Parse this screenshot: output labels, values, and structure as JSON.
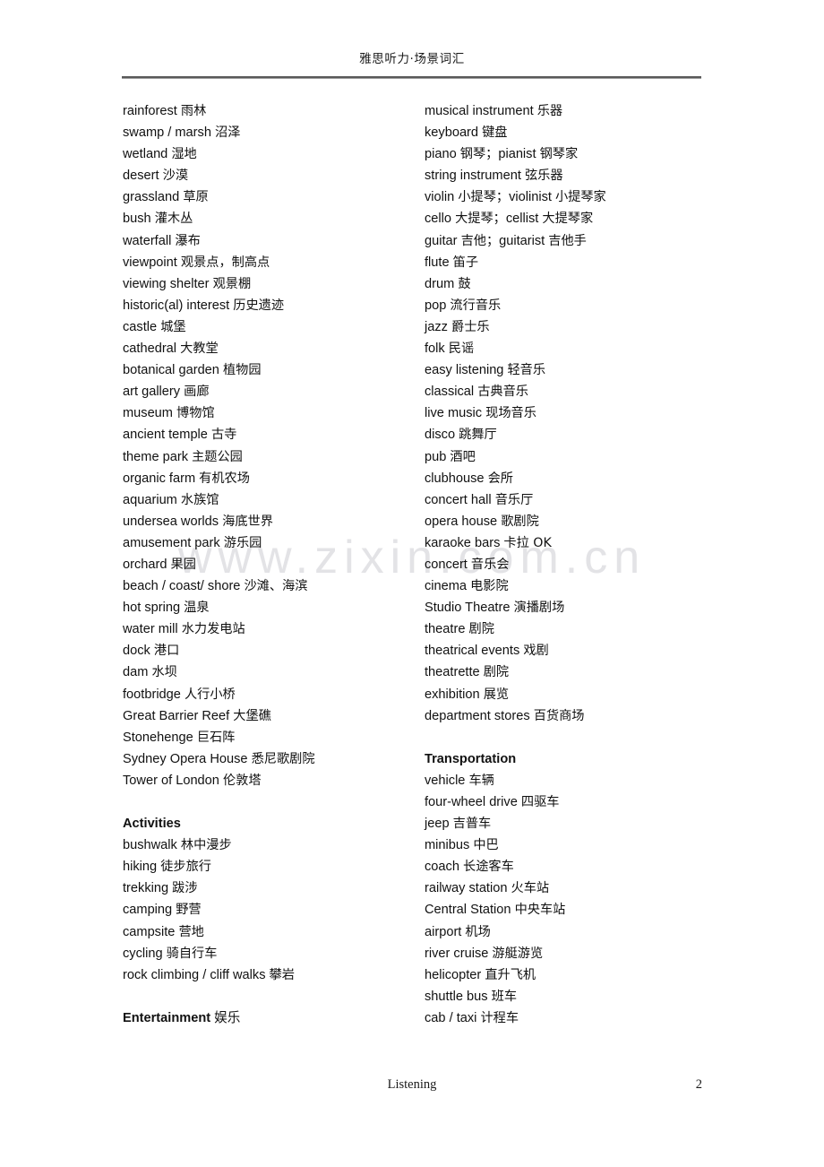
{
  "header": {
    "title": "雅思听力·场景词汇"
  },
  "watermark": {
    "text": "www.zixin.com.cn"
  },
  "footer": {
    "label": "Listening",
    "page_number": "2"
  },
  "left_column": [
    {
      "type": "entry",
      "term": "rainforest ",
      "gloss": "雨林"
    },
    {
      "type": "entry",
      "term": "swamp / marsh ",
      "gloss": " 沼泽"
    },
    {
      "type": "entry",
      "term": "wetland ",
      "gloss": "湿地"
    },
    {
      "type": "entry",
      "term": "desert ",
      "gloss": "沙漠"
    },
    {
      "type": "entry",
      "term": "grassland ",
      "gloss": "草原"
    },
    {
      "type": "entry",
      "term": "bush ",
      "gloss": "灌木丛"
    },
    {
      "type": "entry",
      "term": "waterfall ",
      "gloss": " 瀑布"
    },
    {
      "type": "entry",
      "term": "viewpoint ",
      "gloss": " 观景点，制高点"
    },
    {
      "type": "entry",
      "term": "viewing shelter ",
      "gloss": "观景棚"
    },
    {
      "type": "entry",
      "term": "historic(al) interest ",
      "gloss": "历史遗迹"
    },
    {
      "type": "entry",
      "term": "castle ",
      "gloss": "城堡"
    },
    {
      "type": "entry",
      "term": "cathedral ",
      "gloss": "大教堂"
    },
    {
      "type": "entry",
      "term": "botanical garden ",
      "gloss": "植物园"
    },
    {
      "type": "entry",
      "term": "art gallery ",
      "gloss": "画廊"
    },
    {
      "type": "entry",
      "term": "museum ",
      "gloss": "博物馆"
    },
    {
      "type": "entry",
      "term": "ancient temple ",
      "gloss": "古寺"
    },
    {
      "type": "entry",
      "term": "theme park ",
      "gloss": "主题公园"
    },
    {
      "type": "entry",
      "term": "organic farm ",
      "gloss": "有机农场"
    },
    {
      "type": "entry",
      "term": "aquarium ",
      "gloss": "水族馆"
    },
    {
      "type": "entry",
      "term": "undersea worlds ",
      "gloss": "海底世界"
    },
    {
      "type": "entry",
      "term": "amusement park ",
      "gloss": "游乐园"
    },
    {
      "type": "entry",
      "term": "orchard ",
      "gloss": "果园"
    },
    {
      "type": "entry",
      "term": "beach / coast/ shore ",
      "gloss": "沙滩、海滨"
    },
    {
      "type": "entry",
      "term": "hot spring ",
      "gloss": "温泉"
    },
    {
      "type": "entry",
      "term": "water mill ",
      "gloss": "水力发电站"
    },
    {
      "type": "entry",
      "term": "dock ",
      "gloss": "港口"
    },
    {
      "type": "entry",
      "term": "dam ",
      "gloss": "水坝"
    },
    {
      "type": "entry",
      "term": "footbridge ",
      "gloss": "人行小桥"
    },
    {
      "type": "entry",
      "term": "Great Barrier Reef ",
      "gloss": "大堡礁"
    },
    {
      "type": "entry",
      "term": "Stonehenge ",
      "gloss": "巨石阵"
    },
    {
      "type": "entry",
      "term": "Sydney Opera House ",
      "gloss": "悉尼歌剧院"
    },
    {
      "type": "entry",
      "term": "Tower of London ",
      "gloss": "伦敦塔"
    },
    {
      "type": "spacer",
      "term": "",
      "gloss": ""
    },
    {
      "type": "heading",
      "term": "Activities",
      "gloss": ""
    },
    {
      "type": "entry",
      "term": "bushwalk ",
      "gloss": "林中漫步"
    },
    {
      "type": "entry",
      "term": "hiking ",
      "gloss": "徒步旅行"
    },
    {
      "type": "entry",
      "term": "trekking ",
      "gloss": "跋涉"
    },
    {
      "type": "entry",
      "term": "camping ",
      "gloss": "野营"
    },
    {
      "type": "entry",
      "term": "campsite ",
      "gloss": "营地"
    },
    {
      "type": "entry",
      "term": "cycling ",
      "gloss": "骑自行车"
    },
    {
      "type": "entry",
      "term": "rock climbing / cliff walks ",
      "gloss": "攀岩"
    },
    {
      "type": "spacer",
      "term": "",
      "gloss": ""
    },
    {
      "type": "heading",
      "term": "Entertainment ",
      "gloss": "娱乐"
    }
  ],
  "right_column": [
    {
      "type": "entry",
      "term": "musical instrument ",
      "gloss": "乐器"
    },
    {
      "type": "entry",
      "term": "keyboard ",
      "gloss": "键盘"
    },
    {
      "type": "entry",
      "term": "piano ",
      "gloss": "钢琴；",
      "term2": "pianist ",
      "gloss2": "钢琴家"
    },
    {
      "type": "entry",
      "term": "string instrument ",
      "gloss": "弦乐器"
    },
    {
      "type": "entry",
      "term": "violin ",
      "gloss": "小提琴；",
      "term2": "violinist ",
      "gloss2": "小提琴家"
    },
    {
      "type": "entry",
      "term": "cello ",
      "gloss": "大提琴；",
      "term2": "cellist ",
      "gloss2": "大提琴家"
    },
    {
      "type": "entry",
      "term": "guitar ",
      "gloss": "吉他；",
      "term2": "guitarist ",
      "gloss2": "吉他手"
    },
    {
      "type": "entry",
      "term": "flute ",
      "gloss": "笛子"
    },
    {
      "type": "entry",
      "term": "drum ",
      "gloss": "鼓"
    },
    {
      "type": "entry",
      "term": "pop ",
      "gloss": "流行音乐"
    },
    {
      "type": "entry",
      "term": "jazz ",
      "gloss": "爵士乐"
    },
    {
      "type": "entry",
      "term": "folk ",
      "gloss": "民谣"
    },
    {
      "type": "entry",
      "term": "easy listening ",
      "gloss": "轻音乐"
    },
    {
      "type": "entry",
      "term": "classical ",
      "gloss": "古典音乐"
    },
    {
      "type": "entry",
      "term": "live music ",
      "gloss": "现场音乐"
    },
    {
      "type": "entry",
      "term": "disco ",
      "gloss": "跳舞厅"
    },
    {
      "type": "entry",
      "term": "pub ",
      "gloss": "酒吧"
    },
    {
      "type": "entry",
      "term": "clubhouse ",
      "gloss": "会所"
    },
    {
      "type": "entry",
      "term": "concert hall ",
      "gloss": "音乐厅"
    },
    {
      "type": "entry",
      "term": "opera house ",
      "gloss": "歌剧院"
    },
    {
      "type": "entry",
      "term": "karaoke bars ",
      "gloss": "卡拉 OK"
    },
    {
      "type": "entry",
      "term": "concert ",
      "gloss": "音乐会"
    },
    {
      "type": "entry",
      "term": "cinema ",
      "gloss": "电影院"
    },
    {
      "type": "entry",
      "term": "Studio Theatre ",
      "gloss": "演播剧场"
    },
    {
      "type": "entry",
      "term": "theatre ",
      "gloss": "剧院"
    },
    {
      "type": "entry",
      "term": "theatrical events ",
      "gloss": "戏剧"
    },
    {
      "type": "entry",
      "term": "theatrette ",
      "gloss": " 剧院"
    },
    {
      "type": "entry",
      "term": "exhibition ",
      "gloss": "展览"
    },
    {
      "type": "entry",
      "term": "department stores ",
      "gloss": "百货商场"
    },
    {
      "type": "spacer",
      "term": "",
      "gloss": ""
    },
    {
      "type": "heading",
      "term": "Transportation",
      "gloss": ""
    },
    {
      "type": "entry",
      "term": "vehicle ",
      "gloss": "车辆"
    },
    {
      "type": "entry",
      "term": "four-wheel drive ",
      "gloss": "四驱车"
    },
    {
      "type": "entry",
      "term": "jeep ",
      "gloss": "吉普车"
    },
    {
      "type": "entry",
      "term": "minibus ",
      "gloss": "中巴"
    },
    {
      "type": "entry",
      "term": "coach ",
      "gloss": "长途客车"
    },
    {
      "type": "entry",
      "term": "railway station ",
      "gloss": "火车站"
    },
    {
      "type": "entry",
      "term": "Central Station ",
      "gloss": "中央车站"
    },
    {
      "type": "entry",
      "term": "airport ",
      "gloss": "机场"
    },
    {
      "type": "entry",
      "term": "river cruise ",
      "gloss": "游艇游览"
    },
    {
      "type": "entry",
      "term": "helicopter ",
      "gloss": "直升飞机"
    },
    {
      "type": "entry",
      "term": "shuttle bus ",
      "gloss": "班车"
    },
    {
      "type": "entry",
      "term": "cab / taxi ",
      "gloss": "计程车"
    }
  ]
}
